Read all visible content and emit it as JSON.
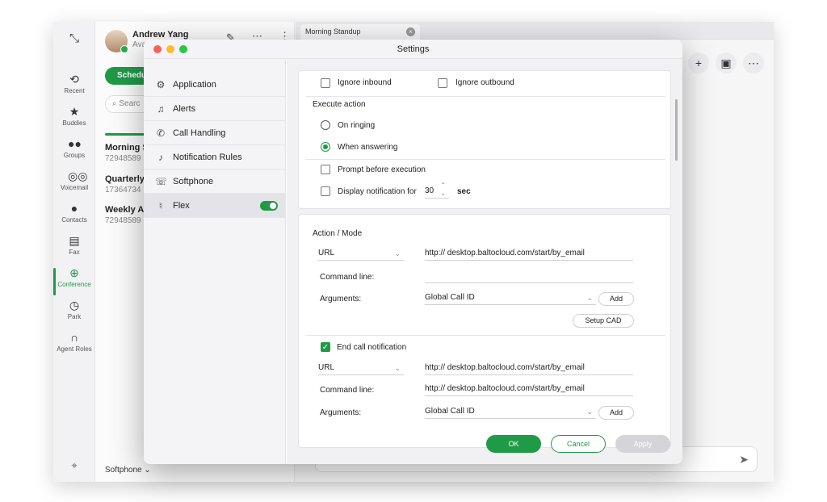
{
  "user": {
    "name": "Andrew Yang",
    "status": "Ava"
  },
  "rail": {
    "items": [
      {
        "label": "Recent",
        "icon": "history-icon"
      },
      {
        "label": "Buddies",
        "icon": "star-icon"
      },
      {
        "label": "Groups",
        "icon": "group-icon"
      },
      {
        "label": "Voicemail",
        "icon": "voicemail-icon"
      },
      {
        "label": "Contacts",
        "icon": "contact-icon"
      },
      {
        "label": "Fax",
        "icon": "fax-icon"
      },
      {
        "label": "Conference",
        "icon": "globe-icon",
        "active": true
      },
      {
        "label": "Park",
        "icon": "park-icon"
      },
      {
        "label": "Agent Roles",
        "icon": "headset-icon"
      }
    ]
  },
  "list": {
    "schedule_label": "Schedu",
    "search_placeholder": "Searc",
    "conferences": [
      {
        "title": "Morning S",
        "number": "72948589"
      },
      {
        "title": "Quarterly",
        "number": "17364734"
      },
      {
        "title": "Weekly A",
        "number": "72948589"
      }
    ],
    "softphone_label": "Softphone ⌄"
  },
  "tab": {
    "label": "Morning Standup"
  },
  "modal": {
    "title": "Settings",
    "nav": [
      {
        "label": "Application",
        "icon": "gear-icon"
      },
      {
        "label": "Alerts",
        "icon": "bell-icon"
      },
      {
        "label": "Call Handling",
        "icon": "phone-icon"
      },
      {
        "label": "Notification Rules",
        "icon": "bell-rules-icon"
      },
      {
        "label": "Softphone",
        "icon": "softphone-icon"
      },
      {
        "label": "Flex",
        "icon": "flex-icon",
        "active": true,
        "toggle": true
      }
    ],
    "events": {
      "ignore_inbound": "Ignore inbound",
      "ignore_outbound": "Ignore outbound",
      "execute_action": "Execute action",
      "on_ringing": "On ringing",
      "when_answering": "When answering",
      "prompt_before": "Prompt before execution",
      "display_notification": "Display notification for",
      "seconds_value": "30",
      "seconds_unit": "sec"
    },
    "action": {
      "heading": "Action / Mode",
      "mode": "URL",
      "url": "http:// desktop.baltocloud.com/start/by_email",
      "command_line_label": "Command line:",
      "command_line_value": "",
      "arguments_label": "Arguments:",
      "arguments_value": "Global Call ID",
      "add_label": "Add",
      "setup_cad_label": "Setup CAD"
    },
    "end_call": {
      "label": "End call notification",
      "mode": "URL",
      "url": "http:// desktop.baltocloud.com/start/by_email",
      "command_line_label": "Command line:",
      "command_line_value": "http:// desktop.baltocloud.com/start/by_email",
      "arguments_label": "Arguments:",
      "arguments_value": "Global Call ID",
      "add_label": "Add"
    },
    "footer": {
      "ok": "OK",
      "cancel": "Cancel",
      "apply": "Apply"
    }
  },
  "colors": {
    "accent": "#1f9a46",
    "close": "#fe5f57",
    "minimize": "#febc2e",
    "maximize": "#28c840"
  }
}
